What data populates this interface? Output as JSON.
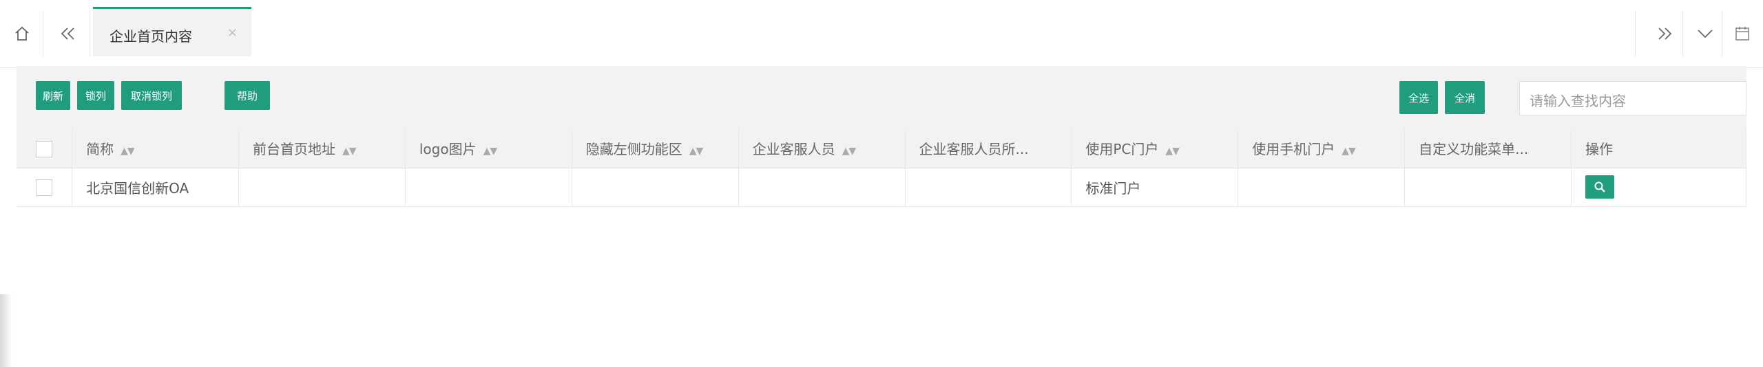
{
  "tabs": [
    {
      "label": "企业首页内容",
      "close_icon": "×"
    }
  ],
  "toolbar": {
    "buttons": [
      "刷新",
      "锁列",
      "取消锁列",
      "帮助"
    ],
    "select_all": "全选",
    "clear_all": "全消",
    "search_placeholder": "请输入查找内容"
  },
  "table": {
    "columns": [
      "简称",
      "前台首页地址",
      "logo图片",
      "隐藏左侧功能区",
      "企业客服人员",
      "企业客服人员所...",
      "使用PC门户",
      "使用手机门户",
      "自定义功能菜单...",
      "操作"
    ],
    "rows": [
      {
        "cells": [
          "北京国信创新OA",
          "",
          "",
          "",
          "",
          "",
          "标准门户",
          "",
          ""
        ]
      }
    ]
  },
  "colors": {
    "accent": "#1f9d7c",
    "header_bg": "#f2f2f2"
  }
}
